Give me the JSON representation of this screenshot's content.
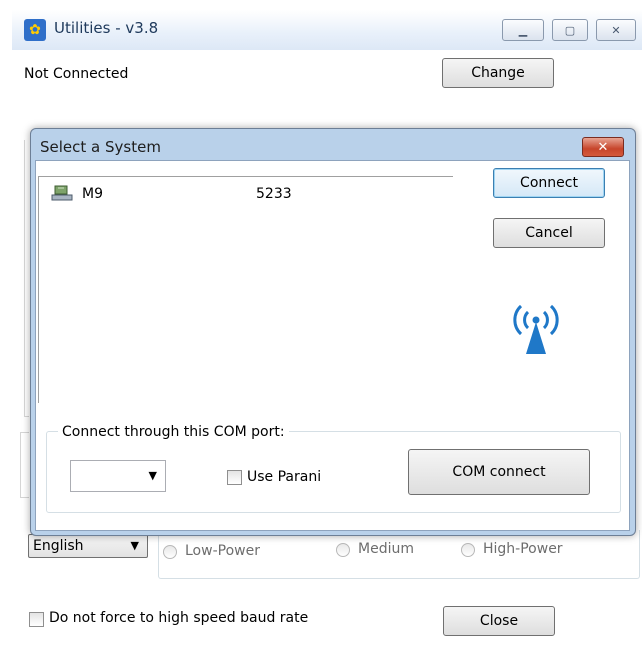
{
  "main": {
    "title": "Utilities - v3.8",
    "icon": "utilities-app-icon",
    "status": "Not Connected",
    "change_button": "Change",
    "language": "English",
    "power_options": [
      "Low-Power",
      "Medium",
      "High-Power"
    ],
    "baud_checkbox_label": "Do not force to high speed baud rate",
    "close_button": "Close"
  },
  "dialog": {
    "title": "Select a System",
    "close_glyph": "✕",
    "systems": [
      {
        "name": "M9",
        "id": "5233",
        "icon": "device-icon"
      }
    ],
    "connect_button": "Connect",
    "cancel_button": "Cancel",
    "wireless_icon": "wireless-signal-icon",
    "com_group_label": "Connect through this COM port:",
    "com_port_value": "",
    "use_parani_label": "Use Parani",
    "com_connect_button": "COM connect"
  },
  "colors": {
    "accent": "#2f6fc9",
    "dialog_frame": "#b9d1ea",
    "close_red": "#c7452b"
  }
}
